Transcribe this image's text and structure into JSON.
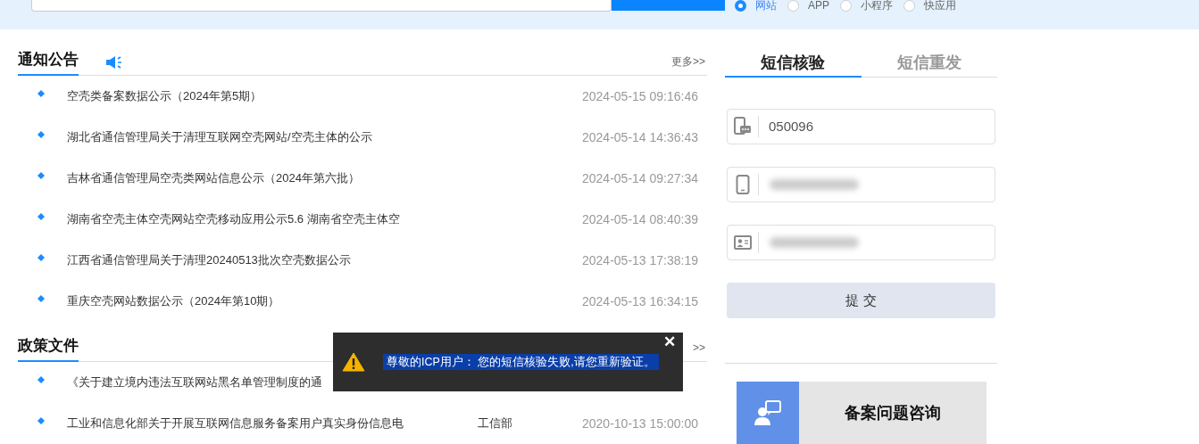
{
  "search": {
    "modes": [
      {
        "label": "网站",
        "selected": true
      },
      {
        "label": "APP",
        "selected": false
      },
      {
        "label": "小程序",
        "selected": false
      },
      {
        "label": "快应用",
        "selected": false
      }
    ]
  },
  "notices": {
    "title": "通知公告",
    "more": "更多>>",
    "items": [
      {
        "title": "空壳类备案数据公示（2024年第5期）",
        "time": "2024-05-15 09:16:46"
      },
      {
        "title": "湖北省通信管理局关于清理互联网空壳网站/空壳主体的公示",
        "time": "2024-05-14 14:36:43"
      },
      {
        "title": "吉林省通信管理局空壳类网站信息公示（2024年第六批）",
        "time": "2024-05-14 09:27:34"
      },
      {
        "title": "湖南省空壳主体空壳网站空壳移动应用公示5.6 湖南省空壳主体空",
        "time": "2024-05-14 08:40:39"
      },
      {
        "title": "江西省通信管理局关于清理20240513批次空壳数据公示",
        "time": "2024-05-13 17:38:19"
      },
      {
        "title": "重庆空壳网站数据公示（2024年第10期）",
        "time": "2024-05-13 16:34:15"
      }
    ]
  },
  "policies": {
    "title": "政策文件",
    "more": ">>",
    "items": [
      {
        "title": "《关于建立境内违法互联网站黑名单管理制度的通"
      },
      {
        "title": "工业和信息化部关于开展互联网信息服务备案用户真实身份信息电",
        "source": "工信部",
        "time": "2020-10-13 15:00:00"
      }
    ]
  },
  "sms": {
    "tabs": [
      {
        "label": "短信核验",
        "selected": true
      },
      {
        "label": "短信重发",
        "selected": false
      }
    ],
    "fields": [
      {
        "kind": "code",
        "value": "050096",
        "blurred": false
      },
      {
        "kind": "phone",
        "blurred": true
      },
      {
        "kind": "id",
        "blurred": true
      }
    ],
    "submit": "提 交"
  },
  "consult": {
    "label": "备案问题咨询"
  },
  "toast": {
    "message": "尊敬的ICP用户： 您的短信核验失败,请您重新验证。",
    "close": "✕"
  }
}
